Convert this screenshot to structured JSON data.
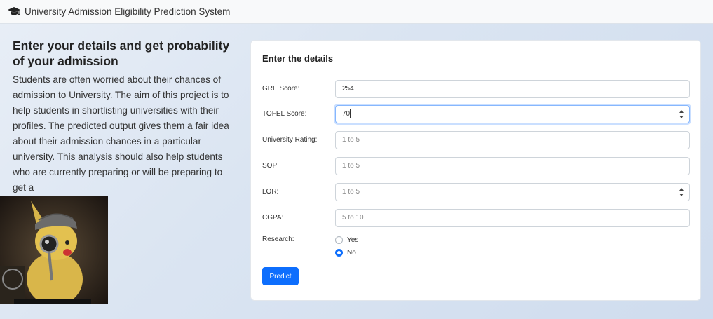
{
  "navbar": {
    "brand": "University Admission Eligibility Prediction System",
    "icon": "graduation-cap-icon"
  },
  "intro": {
    "heading": "Enter your details and get probability of your admission",
    "body": "Students are often worried about their chances of admission to University. The aim of this project is to help students in shortlisting universities with their profiles. The predicted output gives them a fair idea about their admission chances in a particular university. This analysis should also help students who are currently preparing or will be preparing to get a"
  },
  "form": {
    "title": "Enter the details",
    "fields": [
      {
        "label": "GRE Score:",
        "value": "254",
        "placeholder": ""
      },
      {
        "label": "TOFEL Score:",
        "value": "70",
        "placeholder": ""
      },
      {
        "label": "University Rating:",
        "value": "",
        "placeholder": "1 to 5"
      },
      {
        "label": "SOP:",
        "value": "",
        "placeholder": "1 to 5"
      },
      {
        "label": "LOR:",
        "value": "",
        "placeholder": "1 to 5"
      },
      {
        "label": "CGPA:",
        "value": "",
        "placeholder": "5 to 10"
      }
    ],
    "research": {
      "label": "Research:",
      "options": [
        "Yes",
        "No"
      ],
      "selected": "No"
    },
    "submit_label": "Predict"
  },
  "colors": {
    "primary": "#0d6efd",
    "focus_border": "#86b7fe"
  }
}
